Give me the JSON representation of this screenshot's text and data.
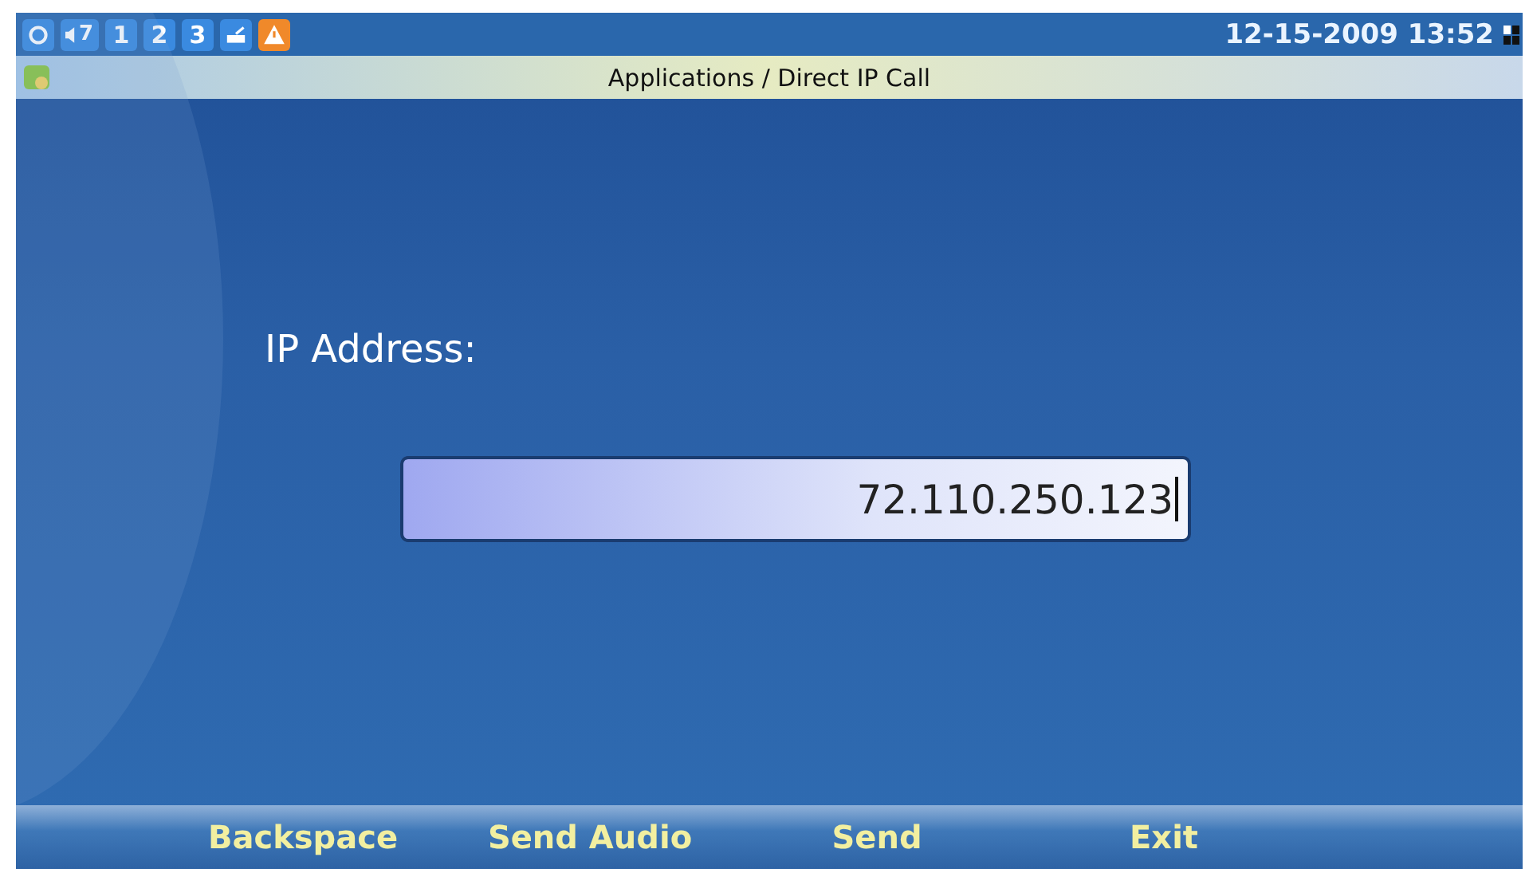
{
  "status_bar": {
    "volume": "7",
    "lines": [
      "1",
      "2",
      "3"
    ],
    "datetime": "12-15-2009 13:52"
  },
  "title_bar": {
    "title": "Applications / Direct IP Call"
  },
  "form": {
    "label": "IP Address:",
    "value": "72.110.250.123"
  },
  "softkeys": [
    "Backspace",
    "Send Audio",
    "Send",
    "Exit"
  ]
}
